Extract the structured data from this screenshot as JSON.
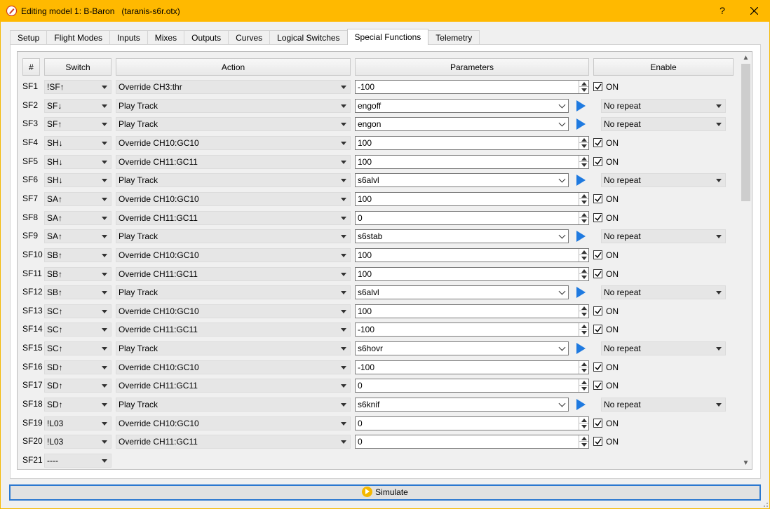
{
  "window": {
    "title": "Editing model 1: B-Baron   (taranis-s6r.otx)",
    "help_label": "?",
    "icon": "pen-icon"
  },
  "tabs": [
    "Setup",
    "Flight Modes",
    "Inputs",
    "Mixes",
    "Outputs",
    "Curves",
    "Logical Switches",
    "Special Functions",
    "Telemetry"
  ],
  "active_tab": "Special Functions",
  "headers": {
    "num": "#",
    "switch": "Switch",
    "action": "Action",
    "parameters": "Parameters",
    "enable": "Enable"
  },
  "functions": [
    {
      "id": "SF1",
      "switch": "!SF↑",
      "action": "Override CH3:thr",
      "param": "-100",
      "kind": "value",
      "enable": "ON"
    },
    {
      "id": "SF2",
      "switch": "SF↓",
      "action": "Play Track",
      "param": "engoff",
      "kind": "track",
      "enable": "No repeat"
    },
    {
      "id": "SF3",
      "switch": "SF↑",
      "action": "Play Track",
      "param": "engon",
      "kind": "track",
      "enable": "No repeat"
    },
    {
      "id": "SF4",
      "switch": "SH↓",
      "action": "Override CH10:GC10",
      "param": "100",
      "kind": "value",
      "enable": "ON"
    },
    {
      "id": "SF5",
      "switch": "SH↓",
      "action": "Override CH11:GC11",
      "param": "100",
      "kind": "value",
      "enable": "ON"
    },
    {
      "id": "SF6",
      "switch": "SH↓",
      "action": "Play Track",
      "param": "s6alvl",
      "kind": "track",
      "enable": "No repeat"
    },
    {
      "id": "SF7",
      "switch": "SA↑",
      "action": "Override CH10:GC10",
      "param": "100",
      "kind": "value",
      "enable": "ON"
    },
    {
      "id": "SF8",
      "switch": "SA↑",
      "action": "Override CH11:GC11",
      "param": "0",
      "kind": "value",
      "enable": "ON"
    },
    {
      "id": "SF9",
      "switch": "SA↑",
      "action": "Play Track",
      "param": "s6stab",
      "kind": "track",
      "enable": "No repeat"
    },
    {
      "id": "SF10",
      "switch": "SB↑",
      "action": "Override CH10:GC10",
      "param": "100",
      "kind": "value",
      "enable": "ON"
    },
    {
      "id": "SF11",
      "switch": "SB↑",
      "action": "Override CH11:GC11",
      "param": "100",
      "kind": "value",
      "enable": "ON"
    },
    {
      "id": "SF12",
      "switch": "SB↑",
      "action": "Play Track",
      "param": "s6alvl",
      "kind": "track",
      "enable": "No repeat"
    },
    {
      "id": "SF13",
      "switch": "SC↑",
      "action": "Override CH10:GC10",
      "param": "100",
      "kind": "value",
      "enable": "ON"
    },
    {
      "id": "SF14",
      "switch": "SC↑",
      "action": "Override CH11:GC11",
      "param": "-100",
      "kind": "value",
      "enable": "ON"
    },
    {
      "id": "SF15",
      "switch": "SC↑",
      "action": "Play Track",
      "param": "s6hovr",
      "kind": "track",
      "enable": "No repeat"
    },
    {
      "id": "SF16",
      "switch": "SD↑",
      "action": "Override CH10:GC10",
      "param": "-100",
      "kind": "value",
      "enable": "ON"
    },
    {
      "id": "SF17",
      "switch": "SD↑",
      "action": "Override CH11:GC11",
      "param": "0",
      "kind": "value",
      "enable": "ON"
    },
    {
      "id": "SF18",
      "switch": "SD↑",
      "action": "Play Track",
      "param": "s6knif",
      "kind": "track",
      "enable": "No repeat"
    },
    {
      "id": "SF19",
      "switch": "!L03",
      "action": "Override CH10:GC10",
      "param": "0",
      "kind": "value",
      "enable": "ON"
    },
    {
      "id": "SF20",
      "switch": "!L03",
      "action": "Override CH11:GC11",
      "param": "0",
      "kind": "value",
      "enable": "ON"
    },
    {
      "id": "SF21",
      "switch": "----",
      "action": "",
      "param": "",
      "kind": "empty",
      "enable": ""
    }
  ],
  "simulate_label": "Simulate",
  "colors": {
    "titlebar": "#ffb900",
    "play_icon": "#1f7ae0",
    "focus_border": "#2b78d0"
  }
}
